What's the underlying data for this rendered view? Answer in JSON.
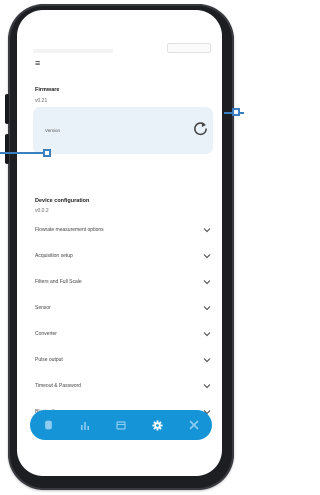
{
  "colors": {
    "accent": "#1594d8",
    "card_bg": "#eaf2f9",
    "marker": "#3a7fbf",
    "phone_frame": "#1d1e22"
  },
  "header": {
    "menu_icon": "hamburger-menu-icon",
    "menu_glyph": "≡"
  },
  "firmware": {
    "title": "Firmware",
    "version": "v0.21",
    "card_label": "Version",
    "refresh_icon": "refresh-icon"
  },
  "device_config": {
    "title": "Device configuration",
    "version": "v0.0.2",
    "items": [
      {
        "label": "Flowrate measurement options"
      },
      {
        "label": "Acquisition setup"
      },
      {
        "label": "Filters and Full Scale"
      },
      {
        "label": "Sensor"
      },
      {
        "label": "Converter"
      },
      {
        "label": "Pulse output"
      },
      {
        "label": "Timeout & Password"
      },
      {
        "label": "Bluetooth"
      }
    ]
  },
  "tabbar": {
    "tabs": [
      {
        "icon": "database-icon",
        "active": false
      },
      {
        "icon": "bar-chart-icon",
        "active": false
      },
      {
        "icon": "calendar-icon",
        "active": false
      },
      {
        "icon": "gear-icon",
        "active": true
      },
      {
        "icon": "tools-icon",
        "active": false
      }
    ]
  }
}
